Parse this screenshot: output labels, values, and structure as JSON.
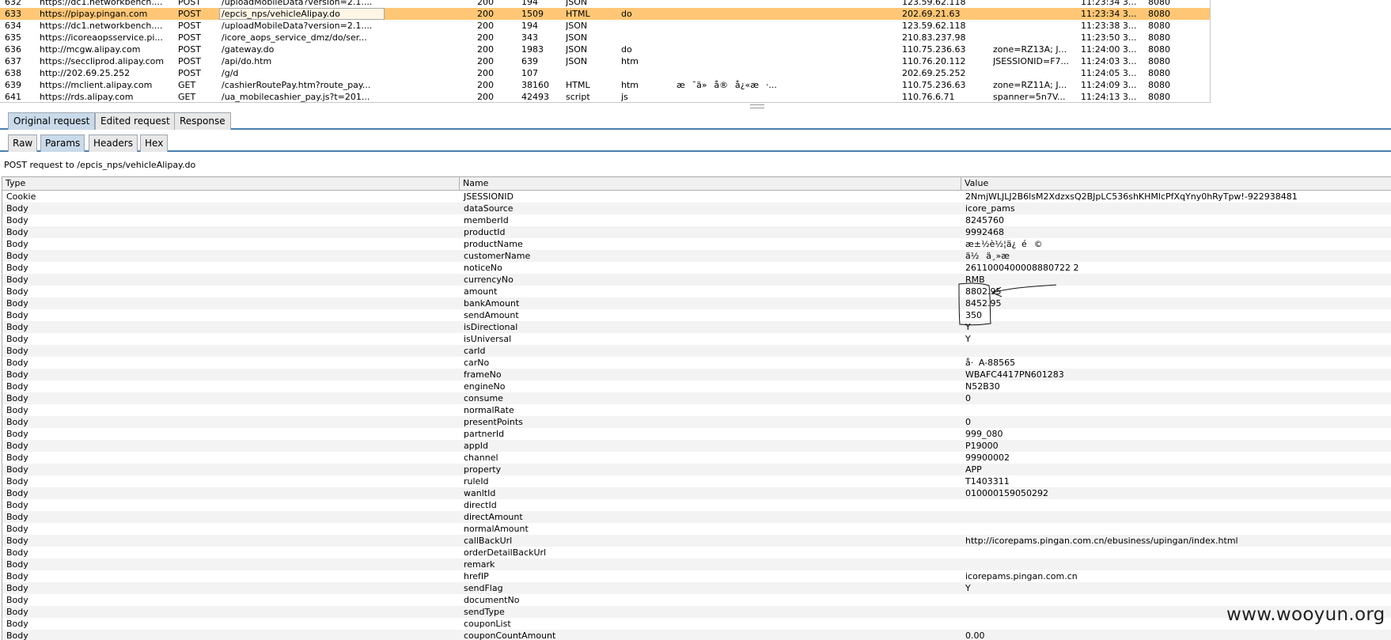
{
  "history": {
    "rows": [
      {
        "num": "632",
        "host": "https://dc1.networkbench....",
        "method": "POST",
        "url": "/uploadMobileData?version=2.1....",
        "params": true,
        "edited": false,
        "status": "200",
        "length": "194",
        "mime": "JSON",
        "ext": "",
        "title": "",
        "ssl": true,
        "ip": "123.59.62.118",
        "cookies": "",
        "time": "11:23:34 3...",
        "port": "8080",
        "selected": false
      },
      {
        "num": "633",
        "host": "https://pipay.pingan.com",
        "method": "POST",
        "url": "/epcis_nps/vehicleAlipay.do",
        "params": true,
        "edited": true,
        "status": "200",
        "length": "1509",
        "mime": "HTML",
        "ext": "do",
        "title": "",
        "ssl": true,
        "ip": "202.69.21.63",
        "cookies": "",
        "time": "11:23:34 3...",
        "port": "8080",
        "selected": true
      },
      {
        "num": "634",
        "host": "https://dc1.networkbench....",
        "method": "POST",
        "url": "/uploadMobileData?version=2.1....",
        "params": true,
        "edited": false,
        "status": "200",
        "length": "194",
        "mime": "JSON",
        "ext": "",
        "title": "",
        "ssl": true,
        "ip": "123.59.62.118",
        "cookies": "",
        "time": "11:23:38 3...",
        "port": "8080",
        "selected": false
      },
      {
        "num": "635",
        "host": "https://icoreaopsservice.pi...",
        "method": "POST",
        "url": "/icore_aops_service_dmz/do/ser...",
        "params": true,
        "edited": false,
        "status": "200",
        "length": "343",
        "mime": "JSON",
        "ext": "",
        "title": "",
        "ssl": true,
        "ip": "210.83.237.98",
        "cookies": "",
        "time": "11:23:50 3...",
        "port": "8080",
        "selected": false
      },
      {
        "num": "636",
        "host": "http://mcgw.alipay.com",
        "method": "POST",
        "url": "/gateway.do",
        "params": true,
        "edited": false,
        "status": "200",
        "length": "1983",
        "mime": "JSON",
        "ext": "do",
        "title": "",
        "ssl": false,
        "ip": "110.75.236.63",
        "cookies": "zone=RZ13A; J...",
        "time": "11:24:00 3...",
        "port": "8080",
        "selected": false
      },
      {
        "num": "637",
        "host": "https://seccliprod.alipay.com",
        "method": "POST",
        "url": "/api/do.htm",
        "params": true,
        "edited": false,
        "status": "200",
        "length": "639",
        "mime": "JSON",
        "ext": "htm",
        "title": "",
        "ssl": true,
        "ip": "110.76.20.112",
        "cookies": "JSESSIONID=F7...",
        "time": "11:24:03 3...",
        "port": "8080",
        "selected": false
      },
      {
        "num": "638",
        "host": "http://202.69.25.252",
        "method": "POST",
        "url": "/g/d",
        "params": true,
        "edited": false,
        "status": "200",
        "length": "107",
        "mime": "",
        "ext": "",
        "title": "",
        "ssl": false,
        "ip": "202.69.25.252",
        "cookies": "",
        "time": "11:24:05 3...",
        "port": "8080",
        "selected": false
      },
      {
        "num": "639",
        "host": "https://mclient.alipay.com",
        "method": "GET",
        "url": "/cashierRoutePay.htm?route_pay...",
        "params": true,
        "edited": false,
        "status": "200",
        "length": "38160",
        "mime": "HTML",
        "ext": "htm",
        "title": "æ¯ä»å®å¿«æ·...",
        "ssl": true,
        "ip": "110.75.236.63",
        "cookies": "zone=RZ11A; J...",
        "time": "11:24:09 3...",
        "port": "8080",
        "selected": false
      },
      {
        "num": "641",
        "host": "https://rds.alipay.com",
        "method": "GET",
        "url": "/ua_mobilecashier_pay.js?t=201...",
        "params": true,
        "edited": false,
        "status": "200",
        "length": "42493",
        "mime": "script",
        "ext": "js",
        "title": "",
        "ssl": true,
        "ip": "110.76.6.71",
        "cookies": "spanner=5n7V...",
        "time": "11:24:13 3...",
        "port": "8080",
        "selected": false
      }
    ]
  },
  "top_tabs": [
    {
      "label": "Original request",
      "active": true
    },
    {
      "label": "Edited request",
      "active": false
    },
    {
      "label": "Response",
      "active": false
    }
  ],
  "sub_tabs": [
    {
      "label": "Raw",
      "active": false
    },
    {
      "label": "Params",
      "active": true
    },
    {
      "label": "Headers",
      "active": false
    },
    {
      "label": "Hex",
      "active": false
    }
  ],
  "request_label": "POST request to /epcis_nps/vehicleAlipay.do",
  "params_table": {
    "headers": {
      "type": "Type",
      "name": "Name",
      "value": "Value"
    },
    "rows": [
      {
        "type": "Cookie",
        "name": "JSESSIONID",
        "value": "2NmjWLJLJ2B6lsM2XdzxsQ2BJpLC536shKHMlcPfXqYny0hRyTpw!-922938481"
      },
      {
        "type": "Body",
        "name": "dataSource",
        "value": "icore_pams"
      },
      {
        "type": "Body",
        "name": "memberId",
        "value": "8245760"
      },
      {
        "type": "Body",
        "name": "productId",
        "value": "9992468"
      },
      {
        "type": "Body",
        "name": "productName",
        "value": "æ±½è½¦ä¿é©"
      },
      {
        "type": "Body",
        "name": "customerName",
        "value": "ä½ä¸»æ"
      },
      {
        "type": "Body",
        "name": "noticeNo",
        "value": "2611000400008880722 2"
      },
      {
        "type": "Body",
        "name": "currencyNo",
        "value": "RMB"
      },
      {
        "type": "Body",
        "name": "amount",
        "value": "8802.95"
      },
      {
        "type": "Body",
        "name": "bankAmount",
        "value": "8452.95"
      },
      {
        "type": "Body",
        "name": "sendAmount",
        "value": "350"
      },
      {
        "type": "Body",
        "name": "isDirectional",
        "value": "Y"
      },
      {
        "type": "Body",
        "name": "isUniversal",
        "value": "Y"
      },
      {
        "type": "Body",
        "name": "carId",
        "value": ""
      },
      {
        "type": "Body",
        "name": "carNo",
        "value": "å·A-88565"
      },
      {
        "type": "Body",
        "name": "frameNo",
        "value": "WBAFC4417PN601283"
      },
      {
        "type": "Body",
        "name": "engineNo",
        "value": "N52B30"
      },
      {
        "type": "Body",
        "name": "consume",
        "value": "0"
      },
      {
        "type": "Body",
        "name": "normalRate",
        "value": ""
      },
      {
        "type": "Body",
        "name": "presentPoints",
        "value": "0"
      },
      {
        "type": "Body",
        "name": "partnerId",
        "value": "999_080"
      },
      {
        "type": "Body",
        "name": "appId",
        "value": "P19000"
      },
      {
        "type": "Body",
        "name": "channel",
        "value": "99900002"
      },
      {
        "type": "Body",
        "name": "property",
        "value": "APP"
      },
      {
        "type": "Body",
        "name": "ruleId",
        "value": "T1403311"
      },
      {
        "type": "Body",
        "name": "wanltId",
        "value": "010000159050292"
      },
      {
        "type": "Body",
        "name": "directId",
        "value": ""
      },
      {
        "type": "Body",
        "name": "directAmount",
        "value": ""
      },
      {
        "type": "Body",
        "name": "normalAmount",
        "value": ""
      },
      {
        "type": "Body",
        "name": "callBackUrl",
        "value": "http://icorepams.pingan.com.cn/ebusiness/upingan/index.html"
      },
      {
        "type": "Body",
        "name": "orderDetailBackUrl",
        "value": ""
      },
      {
        "type": "Body",
        "name": "remark",
        "value": ""
      },
      {
        "type": "Body",
        "name": "hrefIP",
        "value": "icorepams.pingan.com.cn"
      },
      {
        "type": "Body",
        "name": "sendFlag",
        "value": "Y"
      },
      {
        "type": "Body",
        "name": "documentNo",
        "value": ""
      },
      {
        "type": "Body",
        "name": "sendType",
        "value": ""
      },
      {
        "type": "Body",
        "name": "couponList",
        "value": ""
      },
      {
        "type": "Body",
        "name": "couponCountAmount",
        "value": "0.00"
      }
    ]
  },
  "watermark": "www.wooyun.org"
}
